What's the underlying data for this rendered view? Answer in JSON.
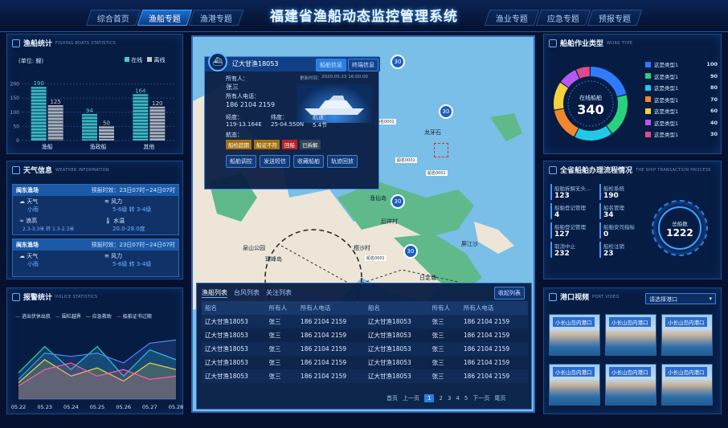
{
  "header": {
    "title": "福建省渔船动态监控管理系统",
    "tabs_left": [
      "综合首页",
      "渔船专题",
      "渔港专题"
    ],
    "tabs_right": [
      "渔业专题",
      "应急专题",
      "预报专题"
    ],
    "active_tab": "渔船专题"
  },
  "fishing_stats": {
    "title": "渔船统计",
    "title_en": "FISHING BOATS STATISTICS",
    "unit": "(单位: 艘)",
    "legend": [
      "在线",
      "离线"
    ],
    "chart_data": {
      "type": "bar",
      "categories": [
        "渔船",
        "渔政船",
        "其他"
      ],
      "series": [
        {
          "name": "在线",
          "values": [
            190,
            94,
            164
          ]
        },
        {
          "name": "离线",
          "values": [
            125,
            50,
            120
          ]
        }
      ],
      "ylim": [
        0,
        250
      ]
    }
  },
  "weather": {
    "title": "天气信息",
    "title_en": "WEATHER INFORMATION",
    "blocks": [
      {
        "place": "闽东渔场",
        "period": "预报时效：23日07时~24日07时",
        "items": [
          {
            "label": "天气",
            "value": "小雨"
          },
          {
            "label": "风力",
            "value": "5-6级 转 3-4级"
          },
          {
            "label": "浪高",
            "value": "2.3-3.3米 转 1.3-2.3米"
          },
          {
            "label": "水温",
            "value": "20.0-28.0度"
          }
        ]
      },
      {
        "place": "闽东渔场",
        "period": "预报时效：23日07时~24日07时",
        "items": [
          {
            "label": "天气",
            "value": "小雨"
          },
          {
            "label": "风力",
            "value": "5-6级 转 3-4级"
          }
        ]
      }
    ]
  },
  "police": {
    "title": "报警统计",
    "title_en": "POLICE STATISTICS",
    "legend": [
      "进出伏休出航",
      "围栏越界",
      "应急救助",
      "船舶证书过期"
    ],
    "chart_data": {
      "type": "area",
      "x": [
        "05.22",
        "05.23",
        "05.24",
        "05.25",
        "05.26",
        "05.27",
        "05.28"
      ],
      "series": [
        {
          "name": "进出伏休出航",
          "values": [
            80,
            160,
            90,
            160,
            70,
            150,
            120
          ],
          "color": "#26d7c6"
        },
        {
          "name": "围栏越界",
          "values": [
            60,
            140,
            130,
            140,
            110,
            170,
            180
          ],
          "color": "#4c8dff"
        },
        {
          "name": "应急救助",
          "values": [
            50,
            120,
            70,
            95,
            55,
            110,
            90
          ],
          "color": "#f3d33c"
        },
        {
          "name": "船舶证书过期",
          "values": [
            40,
            90,
            110,
            70,
            90,
            60,
            70
          ],
          "color": "#ff5fa0"
        }
      ],
      "ylim": [
        0,
        220
      ]
    }
  },
  "popup": {
    "ship": "辽大甘渔18053",
    "tab1": "船舶信息",
    "tab2": "终端信息",
    "owner_label": "所有人：",
    "owner": "张三",
    "update_label": "更新时间：",
    "update": "2020.05.23 16:00:00",
    "phone_label": "所有人电话：",
    "phone": "186 2104 2159",
    "lng_label": "经度：",
    "lng": "119-13.164E",
    "lat_label": "纬度：",
    "lat": "25-04.550N",
    "speed_label": "航速：",
    "speed": "5.4节",
    "status_label": "航态：",
    "tags": [
      "船检超期",
      "船证不符",
      "回船",
      "已拆解"
    ],
    "actions": [
      "船舶调控",
      "发送短信",
      "收藏船舶",
      "轨迹回放"
    ]
  },
  "map": {
    "markers": [
      "30",
      "30",
      "30",
      "30"
    ],
    "labels": [
      "龙牙石",
      "后祥村",
      "屏江沙",
      "梧沙村",
      "泉山公园",
      "珠峰岛",
      "日定塘",
      "渔仙岛"
    ],
    "ship_label": "船名0001"
  },
  "list": {
    "tabs": [
      "渔船列表",
      "台风列表",
      "关注列表"
    ],
    "collapse": "收起列表",
    "headers": [
      "船名",
      "所有人",
      "所有人电话",
      "船名",
      "所有人",
      "所有人电话"
    ],
    "rows": [
      [
        "辽大甘渔18053",
        "张三",
        "186 2104 2159",
        "辽大甘渔18053",
        "张三",
        "186 2104 2159"
      ],
      [
        "辽大甘渔18053",
        "张三",
        "186 2104 2159",
        "辽大甘渔18053",
        "张三",
        "186 2104 2159"
      ],
      [
        "辽大甘渔18053",
        "张三",
        "186 2104 2159",
        "辽大甘渔18053",
        "张三",
        "186 2104 2159"
      ],
      [
        "辽大甘渔18053",
        "张三",
        "186 2104 2159",
        "辽大甘渔18053",
        "张三",
        "186 2104 2159"
      ],
      [
        "辽大甘渔18053",
        "张三",
        "186 2104 2159",
        "辽大甘渔18053",
        "张三",
        "186 2104 2159"
      ]
    ],
    "pager": {
      "first": "首页",
      "prev": "上一页",
      "pages": [
        "1",
        "2",
        "3",
        "4",
        "5"
      ],
      "next": "下一页",
      "last": "尾页",
      "current": "1"
    }
  },
  "worktype": {
    "title": "船舶作业类型",
    "title_en": "WORK TYPE",
    "center_label": "在线船舶",
    "center_value": "340",
    "chart_data": {
      "type": "pie",
      "categories": [
        "这是类型1",
        "这是类型1",
        "这是类型1",
        "这是类型1",
        "这是类型1",
        "这是类型1",
        "这是类型1"
      ],
      "values": [
        100,
        90,
        80,
        70,
        60,
        40,
        30
      ],
      "colors": [
        "#2f7bff",
        "#28d17c",
        "#22c8e8",
        "#f0872c",
        "#f4d23a",
        "#b45af2",
        "#e04a8a"
      ]
    }
  },
  "transaction": {
    "title": "全省船舶办理流程情况",
    "title_en": "THE SHIP TRANSACTION PROCESS",
    "items": [
      {
        "label": "船舶拆解无头...",
        "value": "123"
      },
      {
        "label": "船检系统",
        "value": "190"
      },
      {
        "label": "船舶登记管理",
        "value": "4"
      },
      {
        "label": "船名管理",
        "value": "34"
      },
      {
        "label": "船舶登记管理",
        "value": "127"
      },
      {
        "label": "船舶安司指标",
        "value": "0"
      },
      {
        "label": "取消中止",
        "value": "232"
      },
      {
        "label": "船检注销",
        "value": "23"
      }
    ],
    "total_label": "总船数",
    "total": "1222"
  },
  "port": {
    "title": "港口视频",
    "title_en": "PORT VIDEO",
    "select_placeholder": "请选择港口",
    "thumbs": [
      "小长山岛内港口",
      "小长山岛内港口",
      "小长山岛内港口",
      "小长山岛内港口",
      "小长山岛内港口",
      "小长山岛内港口"
    ]
  }
}
